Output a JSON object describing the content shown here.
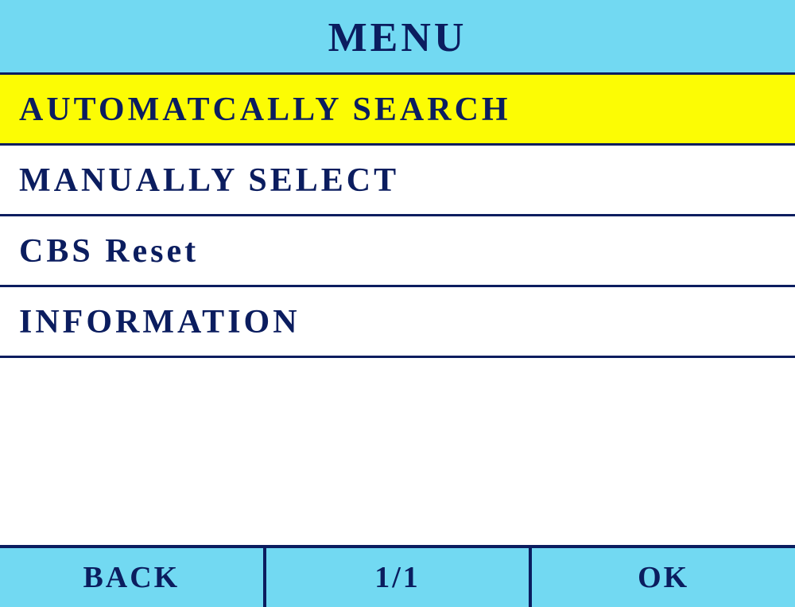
{
  "header": {
    "title": "MENU"
  },
  "menu": {
    "items": [
      {
        "label": "AUTOMATCALLY SEARCH",
        "selected": true
      },
      {
        "label": "MANUALLY SELECT",
        "selected": false
      },
      {
        "label": "CBS Reset",
        "selected": false
      },
      {
        "label": "INFORMATION",
        "selected": false
      }
    ]
  },
  "footer": {
    "back_label": "BACK",
    "page_label": "1/1",
    "ok_label": "OK"
  }
}
